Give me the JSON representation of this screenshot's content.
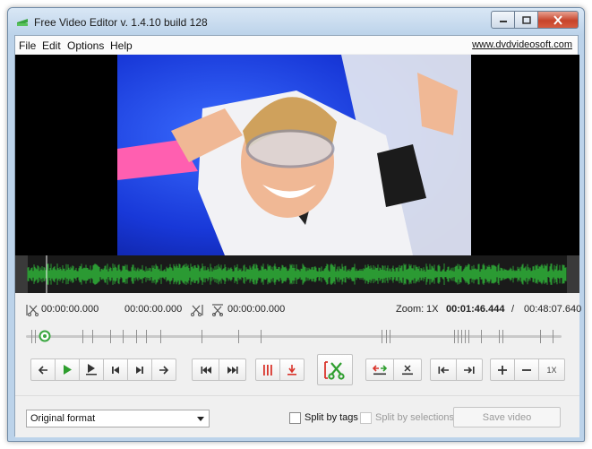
{
  "window": {
    "title": "Free Video Editor v. 1.4.10 build 128"
  },
  "menu": {
    "items": [
      "File",
      "Edit",
      "Options",
      "Help"
    ],
    "website": "www.dvdvideosoft.com"
  },
  "times": {
    "selection_start": "00:00:00.000",
    "selection_end": "00:00:00.000",
    "cut_time": "00:00:00.000",
    "zoom_label": "Zoom:",
    "zoom_value": "1X",
    "current_time": "00:01:46.444",
    "separator": "/",
    "total_duration": "00:48:07.640"
  },
  "toolbar": {
    "zoom_reset_label": "1X"
  },
  "bottom": {
    "format_value": "Original format",
    "split_by_tags_label": "Split by tags",
    "split_by_selections_label": "Split by selections",
    "save_label": "Save video"
  },
  "colors": {
    "accent_green": "#2e9e2e",
    "accent_red": "#d9342b",
    "waveform_green": "#2b9a33"
  },
  "icons": {
    "app": "video-editor-green-icon",
    "play": "play-icon",
    "cut": "scissors-icon"
  }
}
